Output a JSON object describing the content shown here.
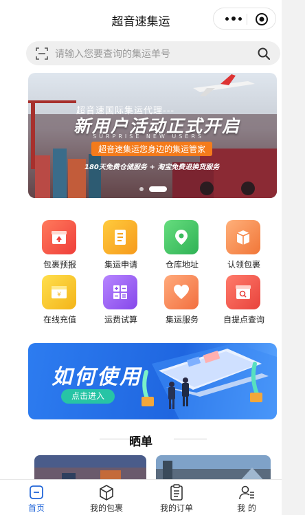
{
  "app": {
    "title": "超音速集运"
  },
  "search": {
    "placeholder": "请输入您要查询的集运单号"
  },
  "banner": {
    "subtitle": "超音速国际集运代理---",
    "headline": "新用户活动正式开启",
    "english": "SURPRISE NEW USERS",
    "pill": "超音速集运您身边的集运管家",
    "line": "180天免费仓储服务 + 淘宝免费退换货服务",
    "dots": 2,
    "active_dot": 2
  },
  "grid": [
    {
      "label": "包裹预报",
      "icon": "box-icon",
      "color": "#f2514a"
    },
    {
      "label": "集运申请",
      "icon": "document-icon",
      "color": "#f9a825"
    },
    {
      "label": "仓库地址",
      "icon": "location-pin-icon",
      "color": "#43c36b"
    },
    {
      "label": "认领包裹",
      "icon": "package-icon",
      "color": "#f5894a"
    },
    {
      "label": "在线充值",
      "icon": "wallet-icon",
      "color": "#f7c531"
    },
    {
      "label": "运费试算",
      "icon": "calculator-icon",
      "color": "#9a5cf0"
    },
    {
      "label": "集运服务",
      "icon": "heart-icon",
      "color": "#f58a54"
    },
    {
      "label": "自提点查询",
      "icon": "store-search-icon",
      "color": "#f0564a"
    }
  ],
  "howto": {
    "title": "如何使用",
    "button": "点击进入"
  },
  "showcase": {
    "title": "晒单"
  },
  "tabs": [
    {
      "label": "首页",
      "icon": "home-icon",
      "active": true
    },
    {
      "label": "我的包裹",
      "icon": "package-tab-icon",
      "active": false
    },
    {
      "label": "我的订单",
      "icon": "clipboard-icon",
      "active": false
    },
    {
      "label": "我 的",
      "icon": "profile-icon",
      "active": false
    }
  ],
  "colors": {
    "accent": "#2266d8",
    "howto_bg": "#2d7cf0",
    "howto_button": "#27c4a5",
    "pill": "#f47b1b"
  }
}
